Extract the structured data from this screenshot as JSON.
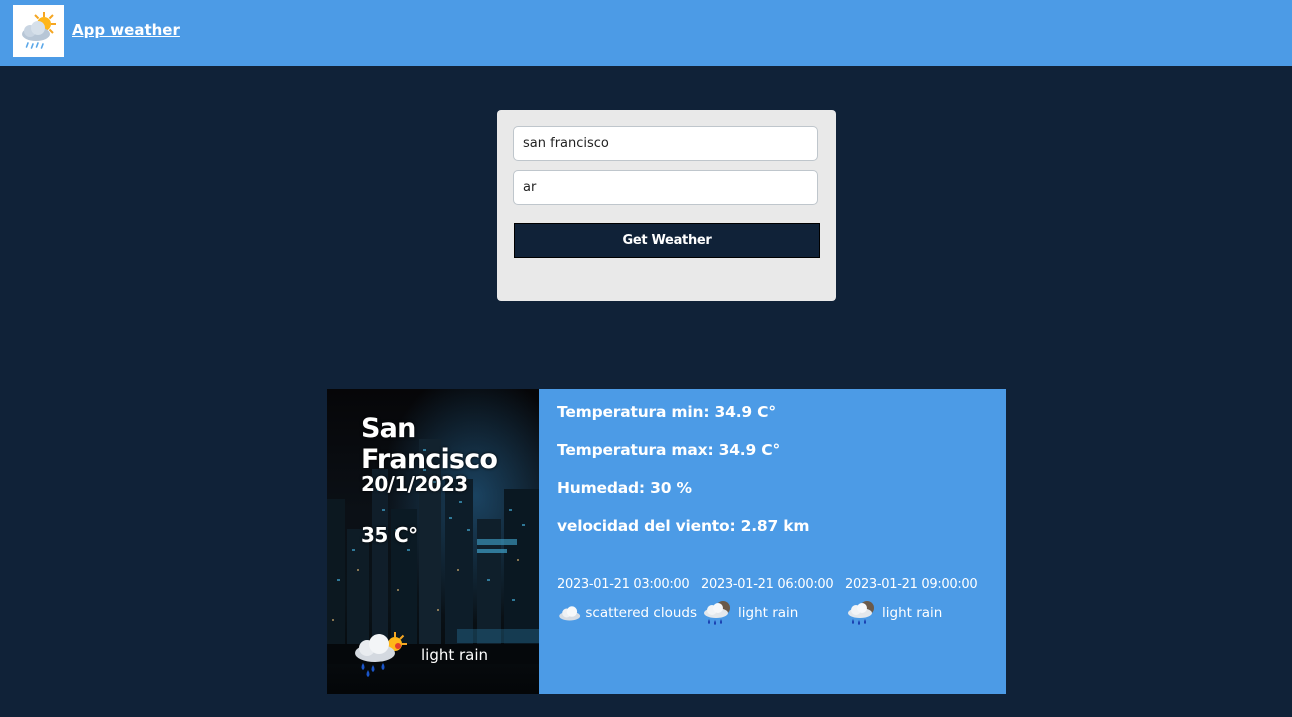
{
  "navbar": {
    "logo_icon": "sun-cloud-rain-icon",
    "brand": "App weather",
    "background": "#4c9be6"
  },
  "form": {
    "city_value": "san francisco",
    "country_value": "ar",
    "submit_label": "Get Weather"
  },
  "result": {
    "city": "San Francisco",
    "date": "20/1/2023",
    "temperature": "35 C°",
    "current_icon": "rain-sun-cloud-icon",
    "current_description": "light rain",
    "details": {
      "temp_min": "Temperatura min: 34.9 C°",
      "temp_max": "Temperatura max: 34.9 C°",
      "humidity": "Humedad: 30 %",
      "wind": "velocidad del viento: 2.87 km"
    },
    "forecast": [
      {
        "time": "2023-01-21 03:00:00",
        "icon": "scattered-clouds-icon",
        "description": "scattered clouds"
      },
      {
        "time": "2023-01-21 06:00:00",
        "icon": "light-rain-icon",
        "description": "light rain"
      },
      {
        "time": "2023-01-21 09:00:00",
        "icon": "light-rain-icon",
        "description": "light rain"
      }
    ]
  },
  "colors": {
    "page_background": "#102238",
    "accent": "#4c9be6",
    "form_card": "#e9e9e9",
    "button": "#102238"
  }
}
